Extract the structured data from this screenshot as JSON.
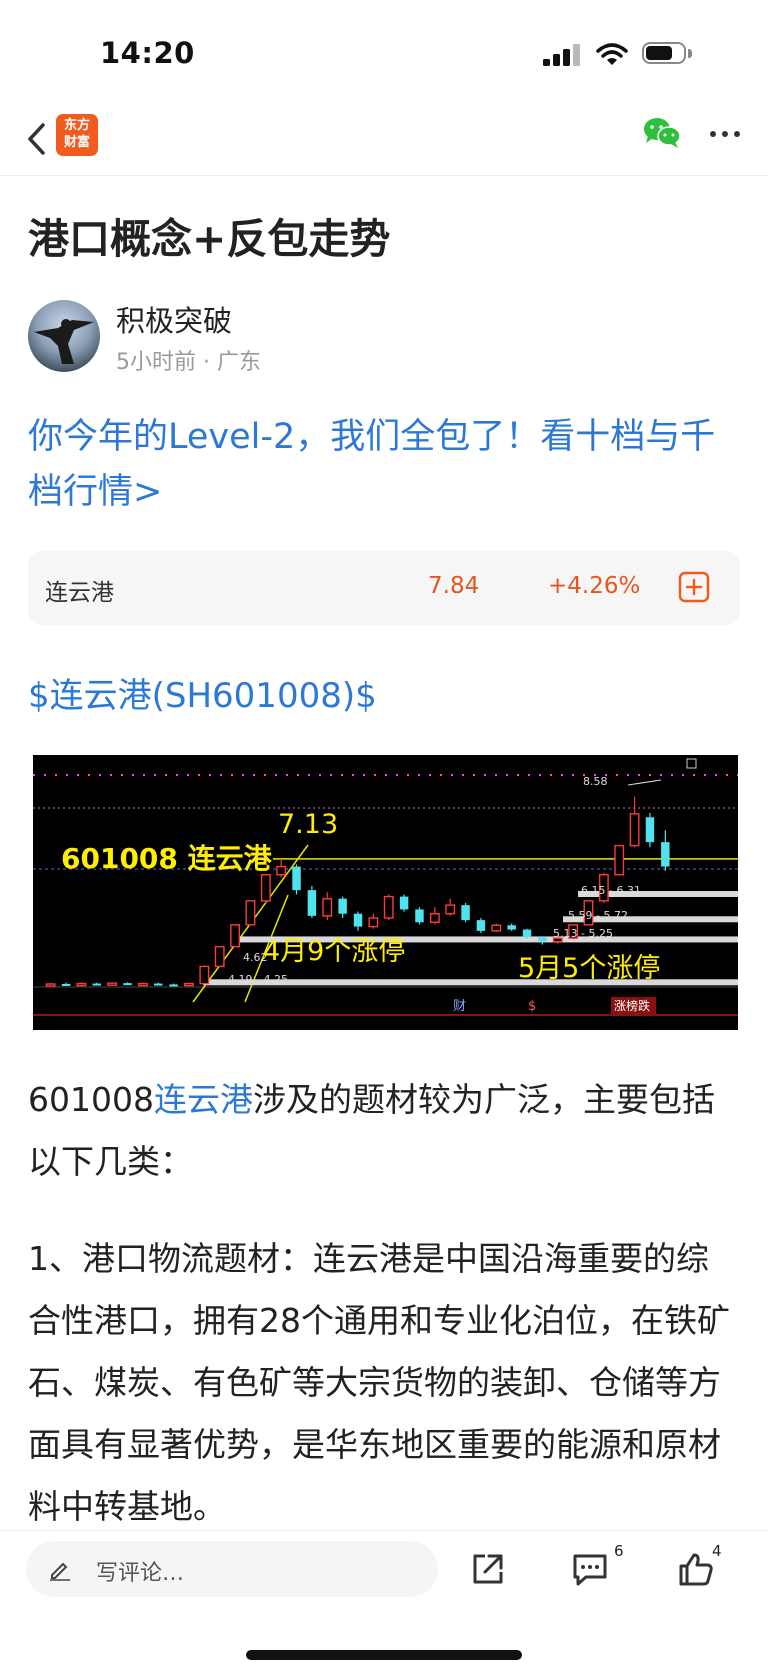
{
  "status": {
    "time": "14:20"
  },
  "nav": {
    "logo_line1": "东方",
    "logo_line2": "财富"
  },
  "article": {
    "title": "港口概念+反包走势",
    "author": "积极突破",
    "meta": "5小时前 · 广东",
    "promo": "你今年的Level-2，我们全包了！看十档与千档行情>",
    "stock_tag": "$连云港(SH601008)$",
    "p1_code": "601008",
    "p1_link": "连云港",
    "p1_rest": "涉及的题材较为广泛，主要包括以下几类：",
    "p2": "1、港口物流题材：连云港是中国沿海重要的综合性港口，拥有28个通用和专业化泊位，在铁矿石、煤炭、有色矿等大宗货物的装卸、仓储等方面具有显著优势，是华东地区重要的能源和原材料中转基地。"
  },
  "quote": {
    "name": "连云港",
    "price": "7.84",
    "change": "+4.26%"
  },
  "chart": {
    "title_label": "601008 连云港",
    "peak1": "7.13",
    "peak2": "8.58",
    "range_a": "4.19 - 4.25",
    "range_b": "4.62",
    "range_c": "5.13 - 5.25",
    "range_d": "5.59 - 5.72",
    "range_e": "6.15 - 6.31",
    "caption_april": "4月9个涨停",
    "caption_may": "5月5个涨停",
    "footer_a": "财",
    "footer_b": "$",
    "footer_c": "涨榜跌"
  },
  "chart_data": {
    "type": "candlestick",
    "candles": [
      {
        "o": 4.19,
        "c": 4.21,
        "h": 4.23,
        "l": 4.18
      },
      {
        "o": 4.21,
        "c": 4.19,
        "h": 4.24,
        "l": 4.18
      },
      {
        "o": 4.2,
        "c": 4.22,
        "h": 4.25,
        "l": 4.18
      },
      {
        "o": 4.22,
        "c": 4.2,
        "h": 4.24,
        "l": 4.18
      },
      {
        "o": 4.2,
        "c": 4.23,
        "h": 4.25,
        "l": 4.19
      },
      {
        "o": 4.23,
        "c": 4.21,
        "h": 4.25,
        "l": 4.19
      },
      {
        "o": 4.21,
        "c": 4.22,
        "h": 4.24,
        "l": 4.19
      },
      {
        "o": 4.22,
        "c": 4.2,
        "h": 4.24,
        "l": 4.18
      },
      {
        "o": 4.2,
        "c": 4.19,
        "h": 4.22,
        "l": 4.17
      },
      {
        "o": 4.19,
        "c": 4.22,
        "h": 4.24,
        "l": 4.18
      },
      {
        "o": 4.22,
        "c": 4.62,
        "h": 4.64,
        "l": 4.2
      },
      {
        "o": 4.62,
        "c": 5.08,
        "h": 5.08,
        "l": 4.6
      },
      {
        "o": 5.08,
        "c": 5.59,
        "h": 5.59,
        "l": 5.08
      },
      {
        "o": 5.59,
        "c": 6.15,
        "h": 6.15,
        "l": 5.59
      },
      {
        "o": 6.15,
        "c": 6.76,
        "h": 6.76,
        "l": 6.1
      },
      {
        "o": 6.76,
        "c": 6.95,
        "h": 7.13,
        "l": 6.7
      },
      {
        "o": 6.95,
        "c": 6.4,
        "h": 7.0,
        "l": 6.3
      },
      {
        "o": 6.4,
        "c": 5.8,
        "h": 6.5,
        "l": 5.75
      },
      {
        "o": 5.8,
        "c": 6.2,
        "h": 6.35,
        "l": 5.7
      },
      {
        "o": 6.2,
        "c": 5.85,
        "h": 6.25,
        "l": 5.75
      },
      {
        "o": 5.85,
        "c": 5.55,
        "h": 5.9,
        "l": 5.45
      },
      {
        "o": 5.55,
        "c": 5.75,
        "h": 5.85,
        "l": 5.5
      },
      {
        "o": 5.75,
        "c": 6.25,
        "h": 6.3,
        "l": 5.7
      },
      {
        "o": 6.25,
        "c": 5.95,
        "h": 6.3,
        "l": 5.9
      },
      {
        "o": 5.95,
        "c": 5.65,
        "h": 6.0,
        "l": 5.6
      },
      {
        "o": 5.65,
        "c": 5.85,
        "h": 6.0,
        "l": 5.6
      },
      {
        "o": 5.85,
        "c": 6.05,
        "h": 6.2,
        "l": 5.8
      },
      {
        "o": 6.05,
        "c": 5.7,
        "h": 6.1,
        "l": 5.65
      },
      {
        "o": 5.7,
        "c": 5.45,
        "h": 5.75,
        "l": 5.4
      },
      {
        "o": 5.45,
        "c": 5.58,
        "h": 5.62,
        "l": 5.42
      },
      {
        "o": 5.58,
        "c": 5.48,
        "h": 5.62,
        "l": 5.45
      },
      {
        "o": 5.48,
        "c": 5.3,
        "h": 5.5,
        "l": 5.25
      },
      {
        "o": 5.3,
        "c": 5.2,
        "h": 5.28,
        "l": 5.13
      },
      {
        "o": 5.2,
        "c": 5.28,
        "h": 5.3,
        "l": 5.15
      },
      {
        "o": 5.28,
        "c": 5.59,
        "h": 5.59,
        "l": 5.25
      },
      {
        "o": 5.59,
        "c": 6.15,
        "h": 6.15,
        "l": 5.59
      },
      {
        "o": 6.15,
        "c": 6.76,
        "h": 6.8,
        "l": 6.1
      },
      {
        "o": 6.76,
        "c": 7.44,
        "h": 7.44,
        "l": 6.76
      },
      {
        "o": 7.44,
        "c": 8.18,
        "h": 8.58,
        "l": 7.4
      },
      {
        "o": 8.1,
        "c": 7.52,
        "h": 8.2,
        "l": 7.4
      },
      {
        "o": 7.52,
        "c": 6.95,
        "h": 7.8,
        "l": 6.85
      }
    ],
    "ylim": [
      4.0,
      8.9
    ],
    "reference_lines": [
      7.13,
      6.31,
      5.72,
      5.25,
      4.25
    ]
  }
}
